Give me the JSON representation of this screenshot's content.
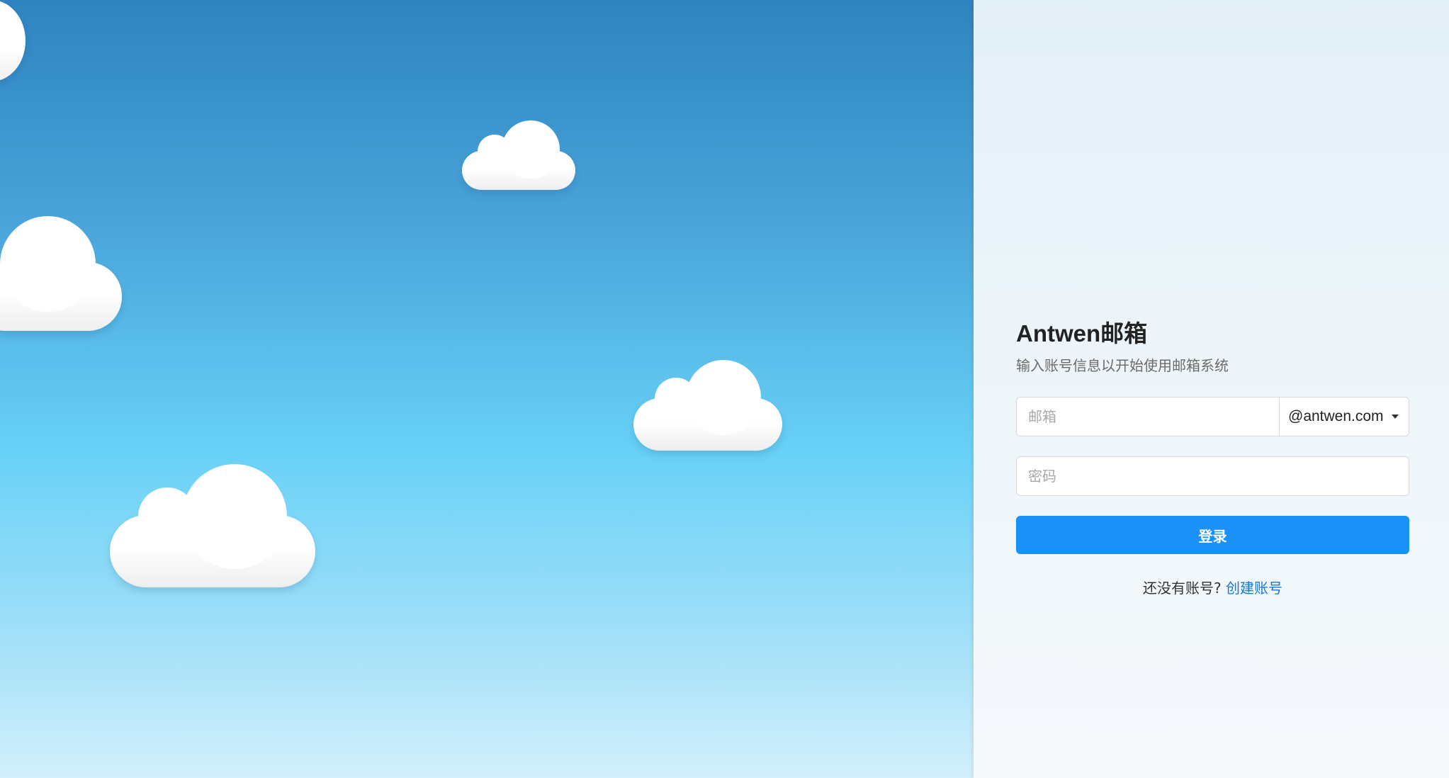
{
  "login": {
    "title": "Antwen邮箱",
    "subtitle": "输入账号信息以开始使用邮箱系统",
    "email_placeholder": "邮箱",
    "domain_selected": "@antwen.com",
    "password_placeholder": "密码",
    "submit_label": "登录",
    "signup_prompt": "还没有账号?",
    "signup_link": "创建账号"
  },
  "colors": {
    "primary": "#1b90f7",
    "link": "#1677d9",
    "sky_top": "#2e84bf",
    "sky_bottom": "#d3f0fc"
  },
  "icons": {
    "domain_dropdown": "caret-down-icon"
  }
}
